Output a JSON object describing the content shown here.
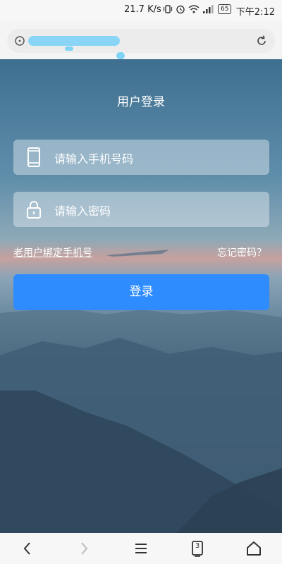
{
  "status_bar": {
    "network_rate": "21.7 K/s",
    "battery": "65",
    "time": "下午2:12"
  },
  "browser": {
    "tabs_count": "3"
  },
  "login": {
    "title": "用户登录",
    "phone_placeholder": "请输入手机号码",
    "password_placeholder": "请输入密码",
    "bind_link": "老用户绑定手机号",
    "forgot_link": "忘记密码？",
    "submit_label": "登录"
  },
  "colors": {
    "accent": "#2f8cff",
    "redaction": "#7fd3f7"
  }
}
